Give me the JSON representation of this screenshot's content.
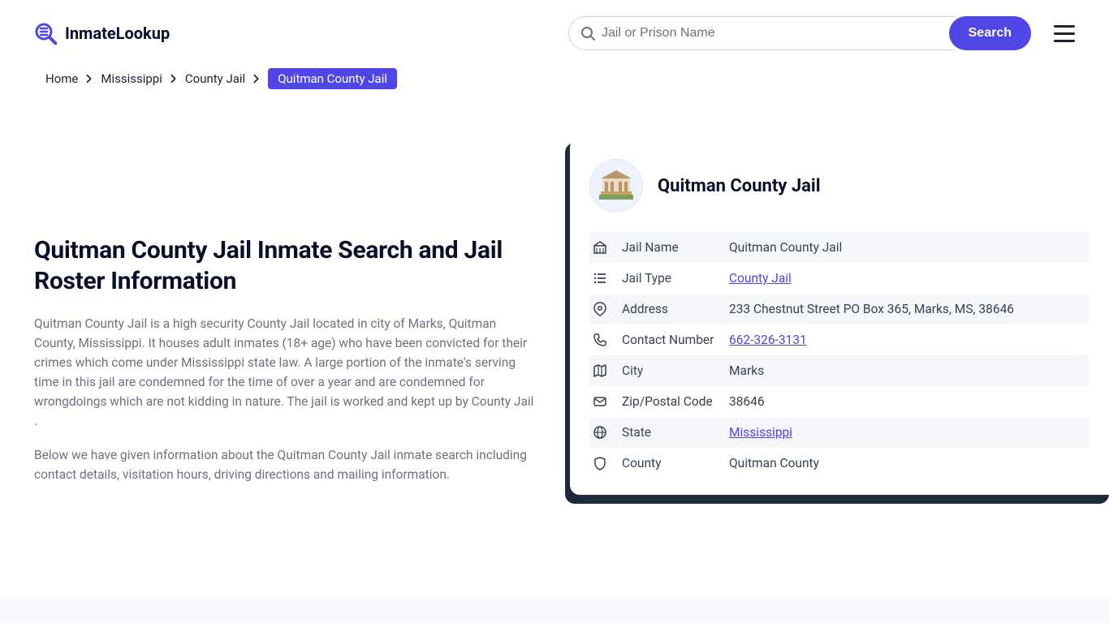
{
  "header": {
    "logo_text": "InmateLookup",
    "search_placeholder": "Jail or Prison Name",
    "search_button": "Search"
  },
  "breadcrumb": {
    "items": [
      "Home",
      "Mississippi",
      "County Jail"
    ],
    "current": "Quitman County Jail"
  },
  "article": {
    "title": "Quitman County Jail Inmate Search and Jail Roster Information",
    "p1": "Quitman County Jail is a high security County Jail located in city of Marks, Quitman County, Mississippi. It houses adult inmates (18+ age) who have been convicted for their crimes which come under Mississippi state law. A large portion of the inmate's serving time in this jail are condemned for the time of over a year and are condemned for wrongdoings which are not kidding in nature. The jail is worked and kept up by County Jail .",
    "p2": "Below we have given information about the Quitman County Jail inmate search including contact details, visitation hours, driving directions and mailing information."
  },
  "card": {
    "title": "Quitman County Jail",
    "rows": [
      {
        "icon": "building-icon",
        "label": "Jail Name",
        "value": "Quitman County Jail",
        "link": false
      },
      {
        "icon": "list-icon",
        "label": "Jail Type",
        "value": "County Jail",
        "link": true
      },
      {
        "icon": "pin-icon",
        "label": "Address",
        "value": "233 Chestnut Street PO Box 365, Marks, MS, 38646",
        "link": false
      },
      {
        "icon": "phone-icon",
        "label": "Contact Number",
        "value": "662-326-3131",
        "link": true
      },
      {
        "icon": "map-icon",
        "label": "City",
        "value": "Marks",
        "link": false
      },
      {
        "icon": "mail-icon",
        "label": "Zip/Postal Code",
        "value": "38646",
        "link": false
      },
      {
        "icon": "globe-icon",
        "label": "State",
        "value": "Mississippi",
        "link": true
      },
      {
        "icon": "shield-icon",
        "label": "County",
        "value": "Quitman County",
        "link": false
      }
    ]
  }
}
